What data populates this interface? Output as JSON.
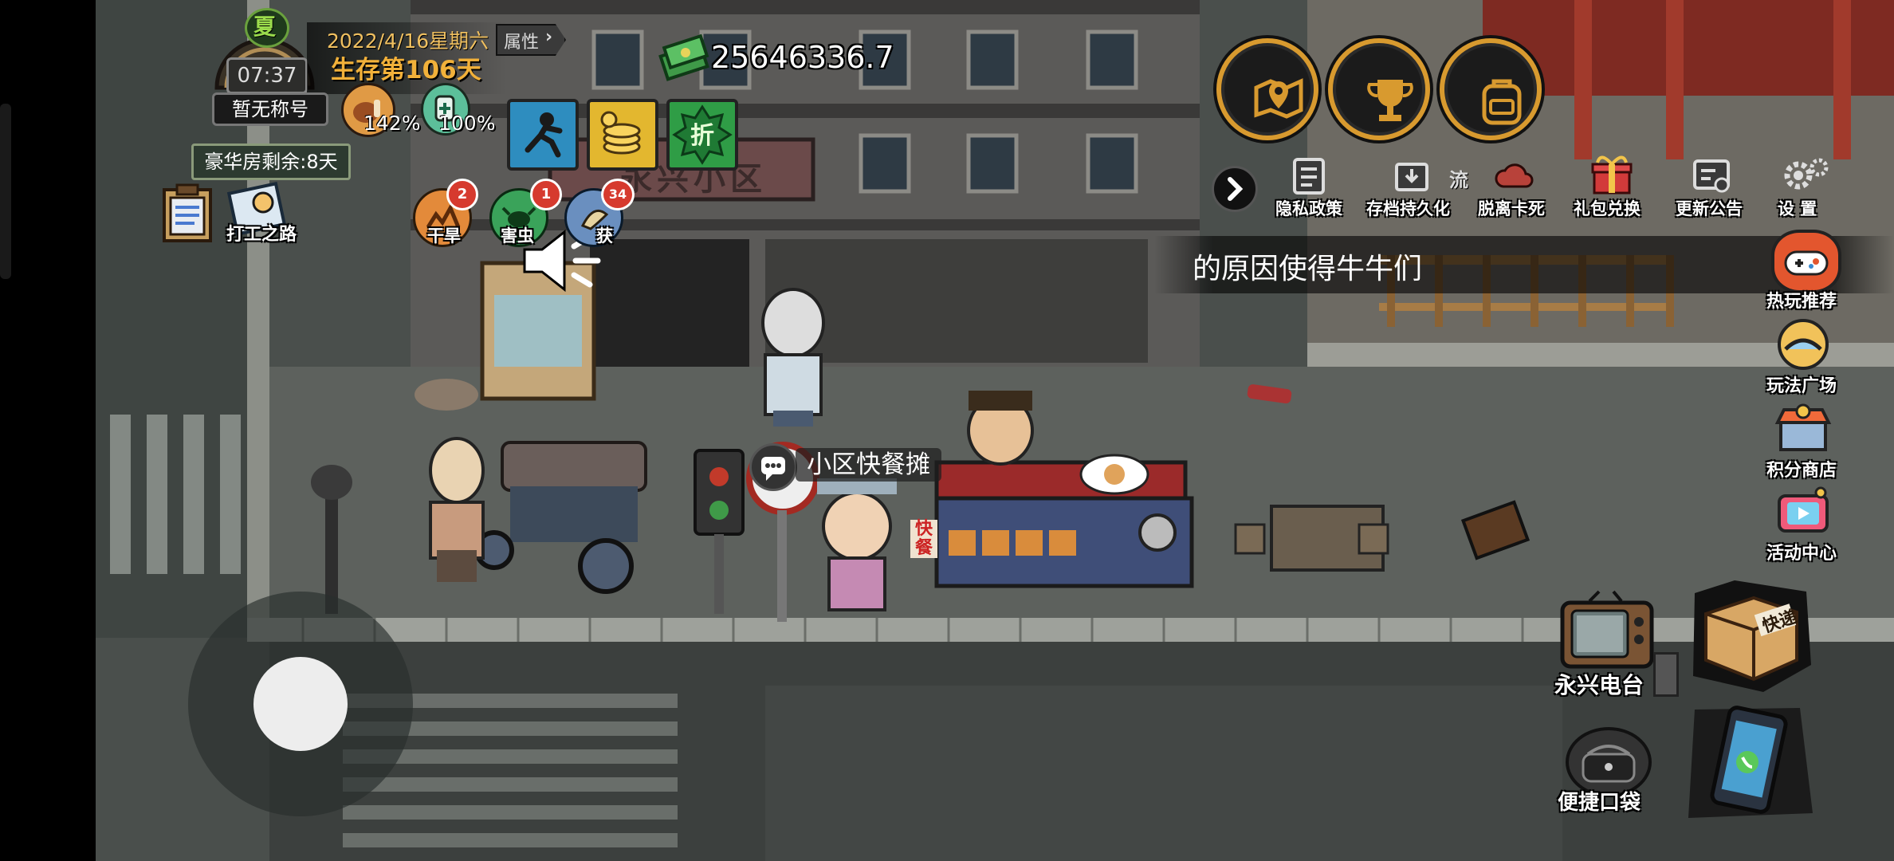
{
  "hud": {
    "season": "夏",
    "clock": "07:37",
    "date": "2022/4/16星期六",
    "survival_day": "生存第106天",
    "attributes_button": "属性",
    "title": "暂无称号",
    "luxury_room": "豪华房剩余:8天",
    "stat_a": "142%",
    "stat_b": "100%",
    "money": "25646336.7",
    "job_road": "打工之路"
  },
  "status_effects": [
    {
      "name": "drought",
      "label": "干旱",
      "badge": "2"
    },
    {
      "name": "pest",
      "label": "害虫",
      "badge": "1"
    },
    {
      "name": "harvest",
      "label": "获",
      "badge": "34"
    }
  ],
  "top_menu": [
    {
      "id": "privacy",
      "label": "隐私政策",
      "icon": "document-icon"
    },
    {
      "id": "save",
      "label": "存档持久化",
      "icon": "save-box-icon"
    },
    {
      "id": "unstuck",
      "label": "脱离卡死",
      "icon": "cloud-icon"
    },
    {
      "id": "gift",
      "label": "礼包兑换",
      "icon": "gift-icon"
    },
    {
      "id": "notice",
      "label": "更新公告",
      "icon": "notice-icon"
    },
    {
      "id": "settings",
      "label": "设 置",
      "icon": "gear-icon"
    }
  ],
  "marquee": "的原因使得牛牛们",
  "marquee_prefix": "流",
  "side_menu": [
    {
      "id": "hot",
      "label": "热玩推荐"
    },
    {
      "id": "plaza",
      "label": "玩法广场"
    },
    {
      "id": "points",
      "label": "积分商店"
    },
    {
      "id": "events",
      "label": "活动中心"
    }
  ],
  "bottom_right": {
    "radio": "永兴电台",
    "pocket": "便捷口袋",
    "express": "快递"
  },
  "scene": {
    "sign": "永兴小区",
    "stall_label": "小区快餐摊",
    "stall_banner": "快餐"
  }
}
